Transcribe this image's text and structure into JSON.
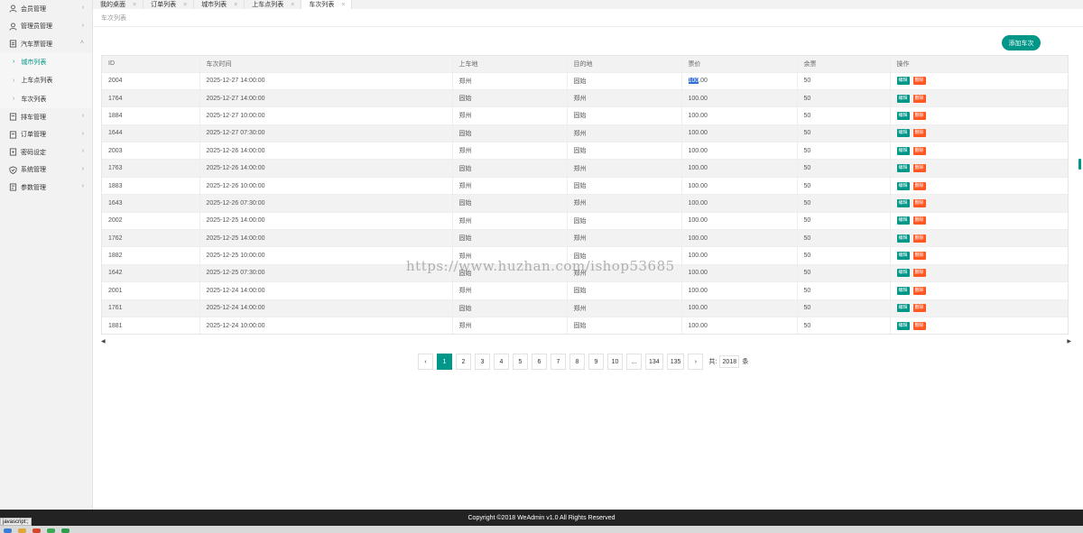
{
  "sidebar": {
    "items": [
      {
        "label": "会员管理",
        "icon": "user-icon"
      },
      {
        "label": "管理员管理",
        "icon": "user-icon"
      },
      {
        "label": "汽车票管理",
        "icon": "ticket-icon",
        "expanded": true
      },
      {
        "label": "排车管理",
        "icon": "doc-icon"
      },
      {
        "label": "订单管理",
        "icon": "doc-icon"
      },
      {
        "label": "密码设定",
        "icon": "key-icon"
      },
      {
        "label": "系统管理",
        "icon": "shield-icon"
      },
      {
        "label": "参数管理",
        "icon": "gear-icon"
      }
    ],
    "sub_items": [
      {
        "label": "城市列表",
        "active": true
      },
      {
        "label": "上车点列表",
        "active": false
      },
      {
        "label": "车次列表",
        "active": false
      }
    ]
  },
  "tabs": [
    {
      "label": "我的桌面",
      "close": "×"
    },
    {
      "label": "订单列表",
      "close": "×"
    },
    {
      "label": "城市列表",
      "close": "×"
    },
    {
      "label": "上车点列表",
      "close": "×"
    },
    {
      "label": "车次列表",
      "close": "×",
      "active": true
    }
  ],
  "breadcrumb": "车次列表",
  "add_button": "添加车次",
  "table": {
    "headers": [
      "ID",
      "车次时间",
      "上车地",
      "目的地",
      "票价",
      "余票",
      "操作"
    ],
    "edit_label": "编辑",
    "delete_label": "删除",
    "rows": [
      [
        "2004",
        "2025-12-27 14:00:00",
        "郑州",
        "固始",
        "100.00",
        "50"
      ],
      [
        "1764",
        "2025-12-27 14:00:00",
        "固始",
        "郑州",
        "100.00",
        "50"
      ],
      [
        "1884",
        "2025-12-27 10:00:00",
        "郑州",
        "固始",
        "100.00",
        "50"
      ],
      [
        "1644",
        "2025-12-27 07:30:00",
        "固始",
        "郑州",
        "100.00",
        "50"
      ],
      [
        "2003",
        "2025-12-26 14:00:00",
        "郑州",
        "固始",
        "100.00",
        "50"
      ],
      [
        "1763",
        "2025-12-26 14:00:00",
        "固始",
        "郑州",
        "100.00",
        "50"
      ],
      [
        "1883",
        "2025-12-26 10:00:00",
        "郑州",
        "固始",
        "100.00",
        "50"
      ],
      [
        "1643",
        "2025-12-26 07:30:00",
        "固始",
        "郑州",
        "100.00",
        "50"
      ],
      [
        "2002",
        "2025-12-25 14:00:00",
        "郑州",
        "固始",
        "100.00",
        "50"
      ],
      [
        "1762",
        "2025-12-25 14:00:00",
        "固始",
        "郑州",
        "100.00",
        "50"
      ],
      [
        "1882",
        "2025-12-25 10:00:00",
        "郑州",
        "固始",
        "100.00",
        "50"
      ],
      [
        "1642",
        "2025-12-25 07:30:00",
        "固始",
        "郑州",
        "100.00",
        "50"
      ],
      [
        "2001",
        "2025-12-24 14:00:00",
        "郑州",
        "固始",
        "100.00",
        "50"
      ],
      [
        "1761",
        "2025-12-24 14:00:00",
        "固始",
        "郑州",
        "100.00",
        "50"
      ],
      [
        "1881",
        "2025-12-24 10:00:00",
        "郑州",
        "固始",
        "100.00",
        "50"
      ]
    ]
  },
  "pagination": {
    "prev": "‹",
    "next": "›",
    "pages": [
      "1",
      "2",
      "3",
      "4",
      "5",
      "6",
      "7",
      "8",
      "9",
      "10",
      "...",
      "134",
      "135"
    ],
    "current": "1",
    "total_prefix": "共:",
    "total": "2018",
    "total_suffix": "条"
  },
  "watermark": "https://www.huzhan.com/ishop53685",
  "footer": "Copyright ©2018 WeAdmin v1.0 All Rights Reserved",
  "status_tip": "javascript:;",
  "colors": {
    "accent": "#009688",
    "danger": "#ff5722",
    "footer_bg": "#232323"
  }
}
